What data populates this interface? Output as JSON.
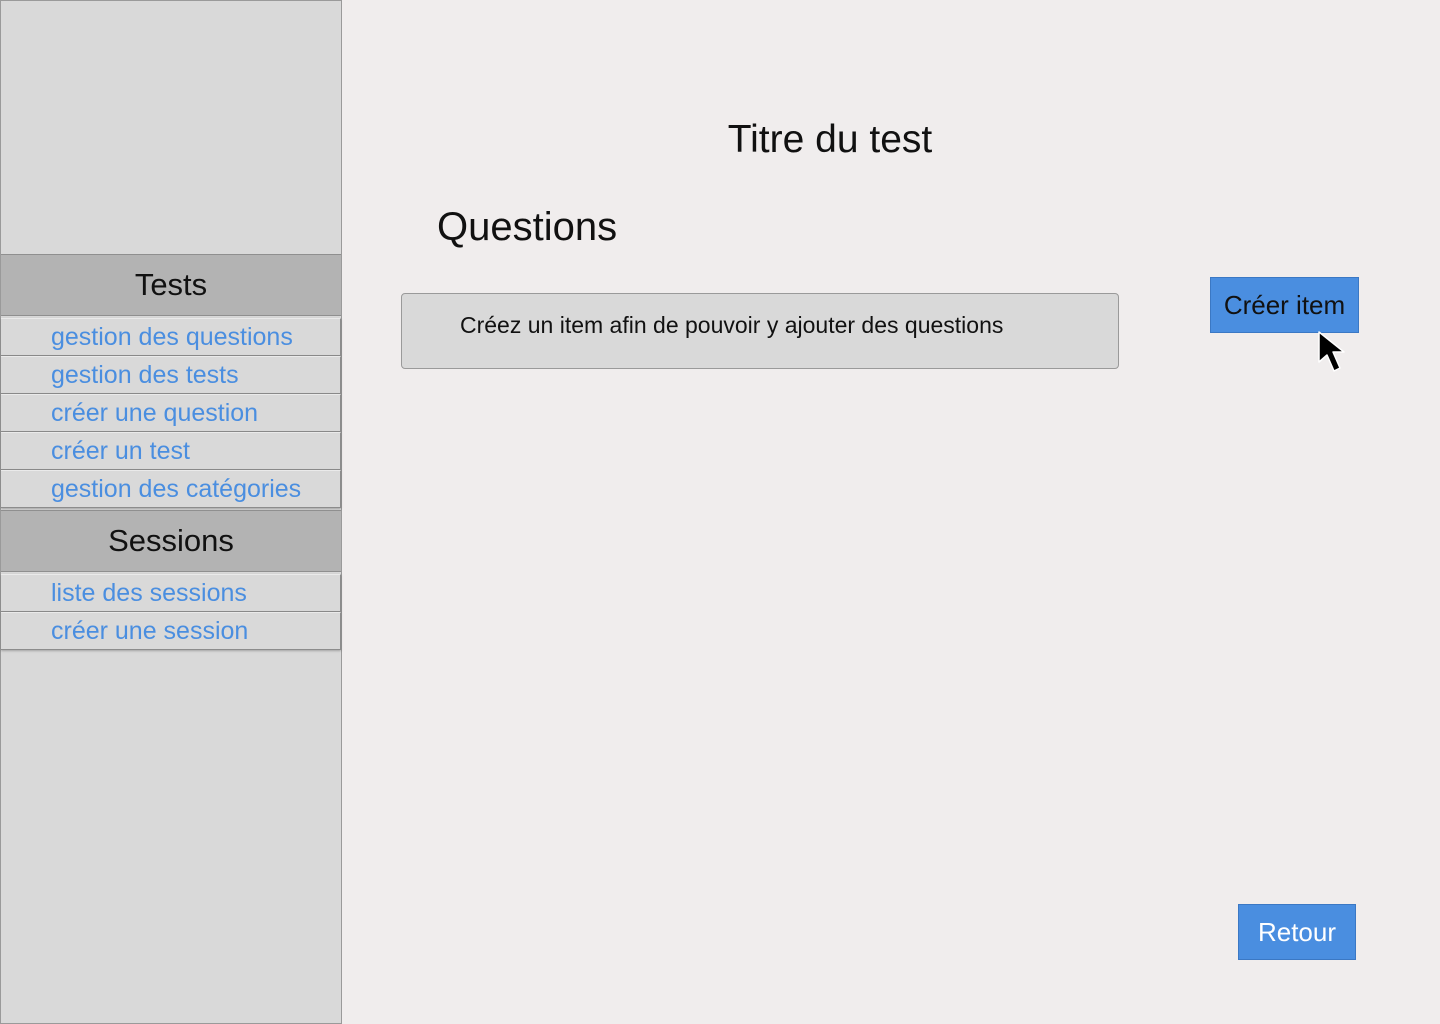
{
  "sidebar": {
    "tests_header": "Tests",
    "tests_items": [
      {
        "label": "gestion des questions"
      },
      {
        "label": "gestion des tests"
      },
      {
        "label": "créer une question"
      },
      {
        "label": "créer un test"
      },
      {
        "label": "gestion des catégories"
      }
    ],
    "sessions_header": "Sessions",
    "sessions_items": [
      {
        "label": "liste des sessions"
      },
      {
        "label": "créer une session"
      }
    ]
  },
  "main": {
    "title": "Titre du test",
    "questions_heading": "Questions",
    "empty_notice": "Créez un item afin de pouvoir y ajouter des questions",
    "create_item_label": "Créer item",
    "back_label": "Retour"
  },
  "icons": {
    "cursor": "arrow-cursor-icon"
  },
  "colors": {
    "accent": "#4a8ee0",
    "link": "#4a8ee0",
    "sidebar_bg": "#d9d9d9",
    "section_header_bg": "#b3b3b3",
    "page_bg": "#f0eded"
  }
}
